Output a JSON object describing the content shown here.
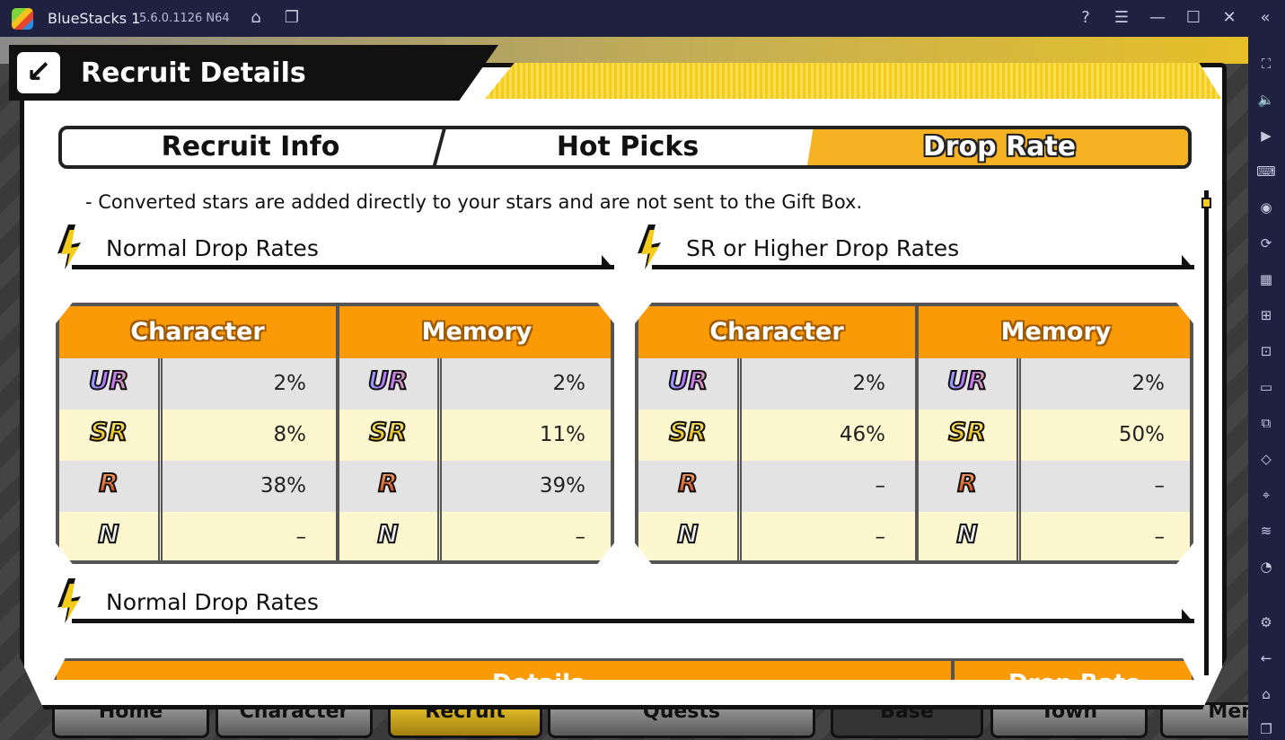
{
  "window": {
    "app_name": "BlueStacks 1",
    "version": "5.6.0.1126 N64"
  },
  "header": {
    "title": "Recruit Details"
  },
  "tabs": [
    {
      "label": "Recruit Info",
      "active": false
    },
    {
      "label": "Hot Picks",
      "active": false
    },
    {
      "label": "Drop Rate",
      "active": true
    }
  ],
  "note": "- Converted stars are added directly to your stars and are not sent to the Gift Box.",
  "sections": [
    {
      "title": "Normal Drop Rates",
      "groups": [
        {
          "header": "Character",
          "rows": [
            {
              "rank": "UR",
              "value": "2%"
            },
            {
              "rank": "SR",
              "value": "8%"
            },
            {
              "rank": "R",
              "value": "38%"
            },
            {
              "rank": "N",
              "value": "–"
            }
          ]
        },
        {
          "header": "Memory",
          "rows": [
            {
              "rank": "UR",
              "value": "2%"
            },
            {
              "rank": "SR",
              "value": "11%"
            },
            {
              "rank": "R",
              "value": "39%"
            },
            {
              "rank": "N",
              "value": "–"
            }
          ]
        }
      ]
    },
    {
      "title": "SR or Higher Drop Rates",
      "groups": [
        {
          "header": "Character",
          "rows": [
            {
              "rank": "UR",
              "value": "2%"
            },
            {
              "rank": "SR",
              "value": "46%"
            },
            {
              "rank": "R",
              "value": "–"
            },
            {
              "rank": "N",
              "value": "–"
            }
          ]
        },
        {
          "header": "Memory",
          "rows": [
            {
              "rank": "UR",
              "value": "2%"
            },
            {
              "rank": "SR",
              "value": "50%"
            },
            {
              "rank": "R",
              "value": "–"
            },
            {
              "rank": "N",
              "value": "–"
            }
          ]
        }
      ]
    }
  ],
  "section3": {
    "title": "Normal Drop Rates",
    "columns": [
      "Details",
      "Drop Rate"
    ]
  },
  "bottom_nav": [
    "Home",
    "Character",
    "Recruit",
    "Quests",
    "Base",
    "Town",
    "Menu"
  ],
  "colors": {
    "accent_orange": "#fa9a06",
    "yellow": "#f5cc1a",
    "row_gray": "#e3e3e3",
    "row_cream": "#fdf7cf",
    "titlebar": "#1e2240"
  },
  "rank_colors": {
    "UR": "#7fd8ff",
    "SR": "#f5d21a",
    "R": "#e0602a",
    "N": "#ffffff"
  }
}
